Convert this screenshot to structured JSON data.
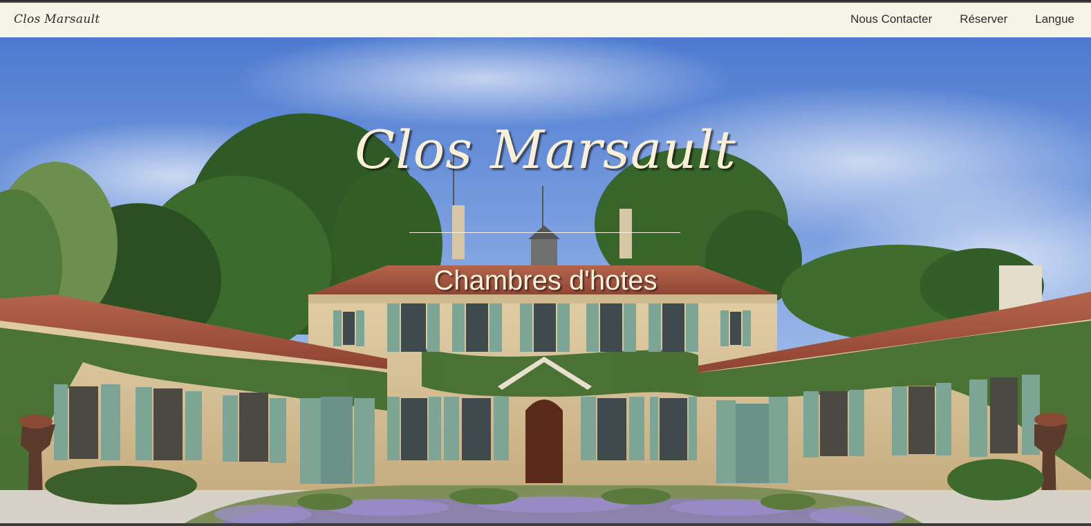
{
  "navbar": {
    "brand": "Clos Marsault",
    "links": [
      {
        "label": "Nous Contacter"
      },
      {
        "label": "Réserver"
      },
      {
        "label": "Langue"
      }
    ]
  },
  "hero": {
    "title": "Clos Marsault",
    "subtitle": "Chambres d'hotes"
  },
  "colors": {
    "navbar_bg": "#f6f4e6",
    "title_text": "#fbefd6",
    "sky_top": "#5d86d6",
    "roof": "#a9553f",
    "shutters": "#7fa89a",
    "stone": "#d7c29a"
  }
}
